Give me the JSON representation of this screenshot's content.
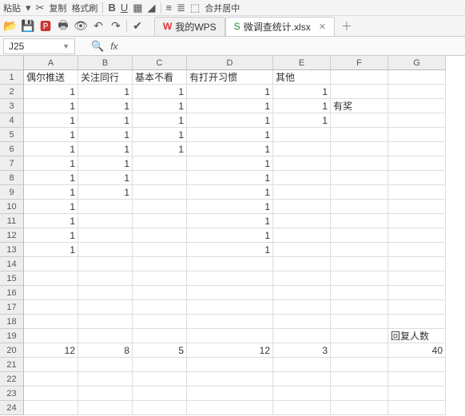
{
  "toolbar1": {
    "paste_label": "粘贴",
    "copy_label": "复制",
    "format_painter_label": "格式刷",
    "merge_center_label": "合并居中"
  },
  "toolbar2": {
    "tabs": [
      {
        "icon": "W",
        "label": "我的WPS"
      },
      {
        "icon": "S",
        "label": "微调查统计.xlsx"
      }
    ]
  },
  "namebox": {
    "value": "J25"
  },
  "columns": [
    "A",
    "B",
    "C",
    "D",
    "E",
    "F",
    "G"
  ],
  "rows_count": 24,
  "cells": {
    "A1": {
      "v": "偶尔推送",
      "t": "txt"
    },
    "B1": {
      "v": "关注同行",
      "t": "txt"
    },
    "C1": {
      "v": "基本不看",
      "t": "txt"
    },
    "D1": {
      "v": "有打开习惯",
      "t": "txt"
    },
    "E1": {
      "v": "其他",
      "t": "txt"
    },
    "A2": {
      "v": "1",
      "t": "num"
    },
    "B2": {
      "v": "1",
      "t": "num"
    },
    "C2": {
      "v": "1",
      "t": "num"
    },
    "D2": {
      "v": "1",
      "t": "num"
    },
    "E2": {
      "v": "1",
      "t": "num"
    },
    "A3": {
      "v": "1",
      "t": "num"
    },
    "B3": {
      "v": "1",
      "t": "num"
    },
    "C3": {
      "v": "1",
      "t": "num"
    },
    "D3": {
      "v": "1",
      "t": "num"
    },
    "E3": {
      "v": "1",
      "t": "num"
    },
    "F3": {
      "v": "有奖",
      "t": "txt"
    },
    "A4": {
      "v": "1",
      "t": "num"
    },
    "B4": {
      "v": "1",
      "t": "num"
    },
    "C4": {
      "v": "1",
      "t": "num"
    },
    "D4": {
      "v": "1",
      "t": "num"
    },
    "E4": {
      "v": "1",
      "t": "num"
    },
    "A5": {
      "v": "1",
      "t": "num"
    },
    "B5": {
      "v": "1",
      "t": "num"
    },
    "C5": {
      "v": "1",
      "t": "num"
    },
    "D5": {
      "v": "1",
      "t": "num"
    },
    "A6": {
      "v": "1",
      "t": "num"
    },
    "B6": {
      "v": "1",
      "t": "num"
    },
    "C6": {
      "v": "1",
      "t": "num"
    },
    "D6": {
      "v": "1",
      "t": "num"
    },
    "A7": {
      "v": "1",
      "t": "num"
    },
    "B7": {
      "v": "1",
      "t": "num"
    },
    "D7": {
      "v": "1",
      "t": "num"
    },
    "A8": {
      "v": "1",
      "t": "num"
    },
    "B8": {
      "v": "1",
      "t": "num"
    },
    "D8": {
      "v": "1",
      "t": "num"
    },
    "A9": {
      "v": "1",
      "t": "num"
    },
    "B9": {
      "v": "1",
      "t": "num"
    },
    "D9": {
      "v": "1",
      "t": "num"
    },
    "A10": {
      "v": "1",
      "t": "num"
    },
    "D10": {
      "v": "1",
      "t": "num"
    },
    "A11": {
      "v": "1",
      "t": "num"
    },
    "D11": {
      "v": "1",
      "t": "num"
    },
    "A12": {
      "v": "1",
      "t": "num"
    },
    "D12": {
      "v": "1",
      "t": "num"
    },
    "A13": {
      "v": "1",
      "t": "num"
    },
    "D13": {
      "v": "1",
      "t": "num"
    },
    "G19": {
      "v": "回复人数",
      "t": "txt"
    },
    "A20": {
      "v": "12",
      "t": "num"
    },
    "B20": {
      "v": "8",
      "t": "num"
    },
    "C20": {
      "v": "5",
      "t": "num"
    },
    "D20": {
      "v": "12",
      "t": "num"
    },
    "E20": {
      "v": "3",
      "t": "num"
    },
    "G20": {
      "v": "40",
      "t": "num"
    }
  }
}
